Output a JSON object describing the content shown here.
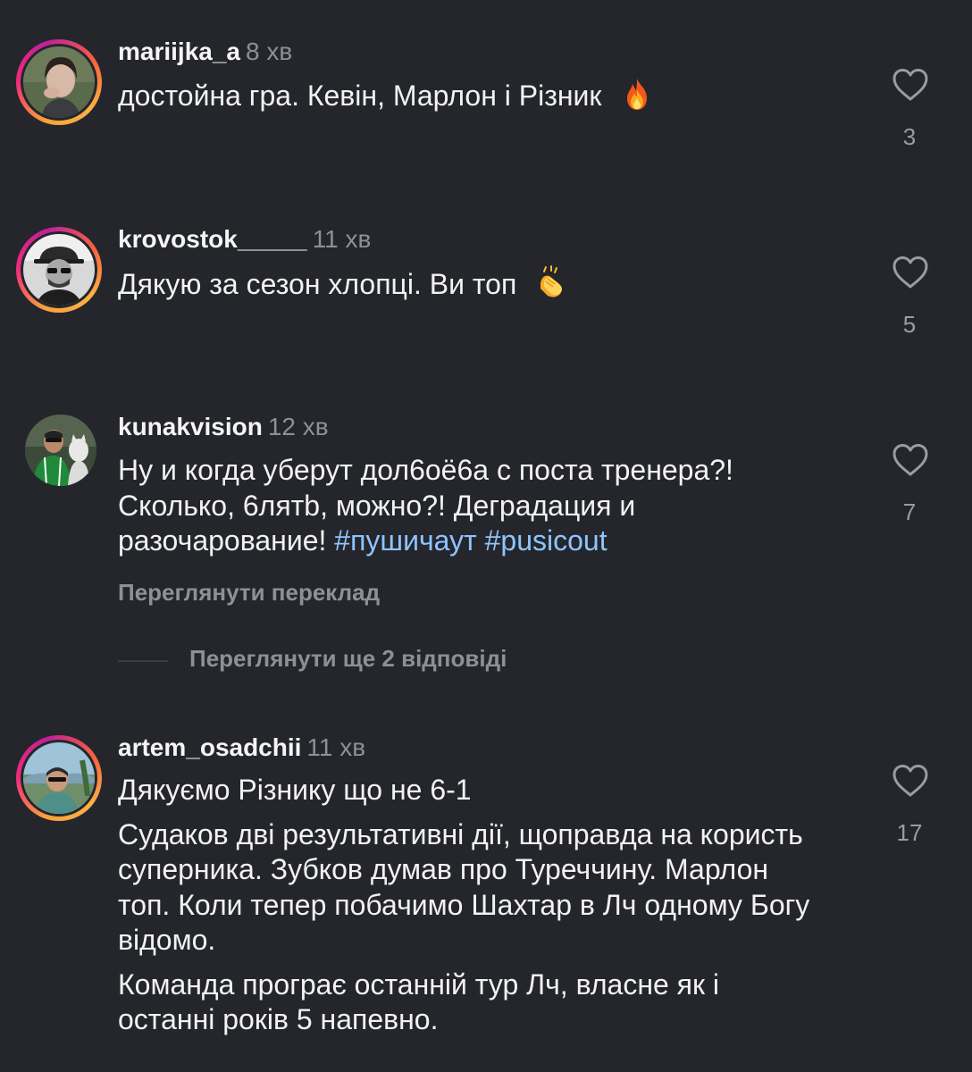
{
  "comments": [
    {
      "username": "mariijka_a",
      "time": "8 хв",
      "text": "достойна гра. Кевін, Марлон і Різник",
      "emoji": "fire-emoji",
      "likes": "3",
      "avatar": "story-ring"
    },
    {
      "username": "krovostok_____",
      "time": "11 хв",
      "text": "Дякую за сезон хлопці. Ви топ",
      "emoji": "clapping-hands-emoji",
      "likes": "5",
      "avatar": "story-ring"
    },
    {
      "username": "kunakvision",
      "time": "12 хв",
      "text_line1": "Ну и когда уберут дол6оё6а с поста тренера?!",
      "text_line2": "Сколько, 6лятb, можно?! Деградация и",
      "text_line3": "разочарование!",
      "hashtags": "#пушичаут #pusicout",
      "likes": "7",
      "translate": "Переглянути переклад",
      "replies": "Переглянути ще 2 відповіді",
      "avatar": "plain"
    },
    {
      "username": "artem_osadchii",
      "time": "11 хв",
      "paragraph1": "Дякуємо Різнику що не 6-1",
      "paragraph2": "Судаков дві результативні дії, щоправда на користь суперника.  Зубков думав про Туреччину. Марлон топ. Коли тепер побачимо Шахтар в Лч одному Богу відомо.",
      "paragraph3": "Команда програє останній тур Лч, власне як і останні років 5 напевно.",
      "likes": "17",
      "avatar": "story-ring"
    }
  ],
  "colors": {
    "background": "#24262b",
    "hashtag": "#8fc4ff",
    "muted": "#8e9096"
  }
}
